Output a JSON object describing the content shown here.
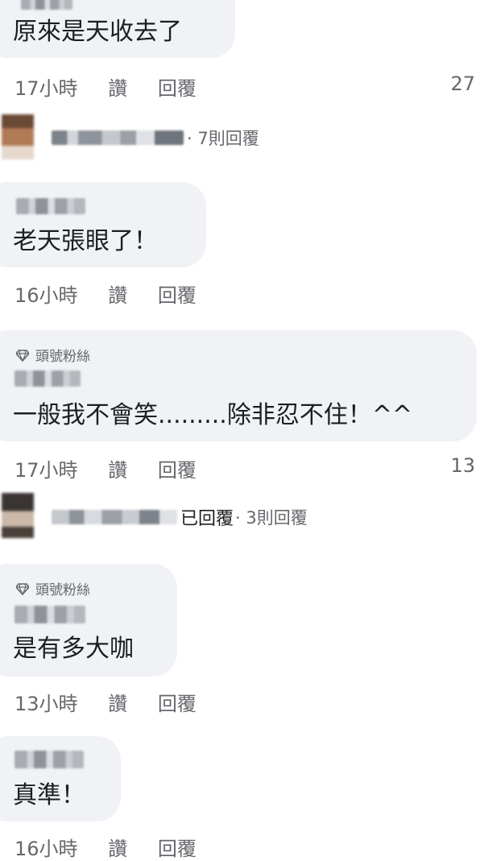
{
  "comments": [
    {
      "text": "原來是天收去了",
      "time": "17小時",
      "like_label": "讚",
      "reply_label": "回覆",
      "reaction_count": "27"
    },
    {
      "text": "老天張眼了！",
      "time": "16小時",
      "like_label": "讚",
      "reply_label": "回覆"
    },
    {
      "badge": "頭號粉絲",
      "text": "一般我不會笑.........除非忍不住！^^",
      "time": "17小時",
      "like_label": "讚",
      "reply_label": "回覆",
      "reaction_count": "13"
    },
    {
      "badge": "頭號粉絲",
      "text": "是有多大咖",
      "time": "13小時",
      "like_label": "讚",
      "reply_label": "回覆"
    },
    {
      "text": "真準！",
      "time": "16小時",
      "like_label": "讚",
      "reply_label": "回覆"
    }
  ],
  "reply_threads": [
    {
      "summary": "· 7則回覆"
    },
    {
      "replied_label": "已回覆",
      "summary": "· 3則回覆"
    }
  ],
  "colors": {
    "bubble": "#f0f2f5",
    "meta_text": "#65676b",
    "primary_text": "#1c1e21"
  },
  "icons": {
    "badge": "diamond-icon"
  }
}
